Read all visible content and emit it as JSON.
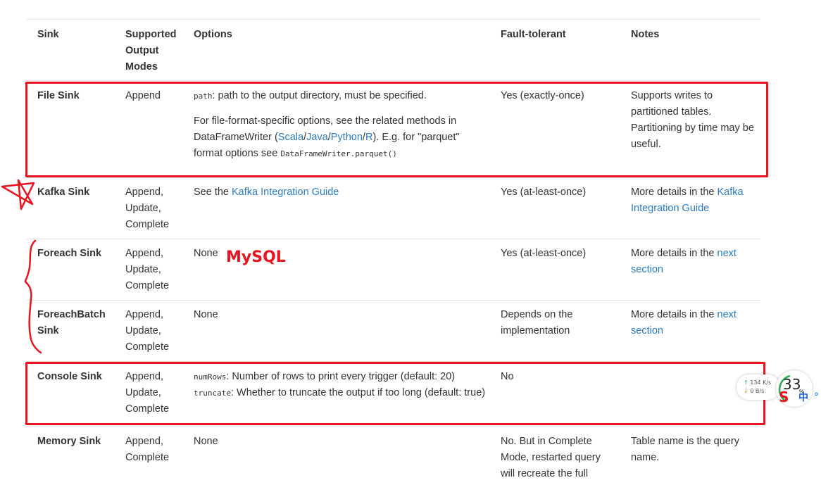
{
  "table": {
    "headers": {
      "sink": "Sink",
      "modes": "Supported Output Modes",
      "options": "Options",
      "fault": "Fault-tolerant",
      "notes": "Notes"
    },
    "rows": [
      {
        "sink": "File Sink",
        "modes": "Append",
        "options": {
          "code1": "path",
          "text1": ": path to the output directory, must be specified.",
          "p2_pre": "For file-format-specific options, see the related methods in DataFrameWriter (",
          "links": [
            "Scala",
            "Java",
            "Python",
            "R"
          ],
          "p2_mid": "). E.g. for \"parquet\" format options see ",
          "code2": "DataFrameWriter.parquet()"
        },
        "fault": "Yes (exactly-once)",
        "notes": "Supports writes to partitioned tables. Partitioning by time may be useful."
      },
      {
        "sink": "Kafka Sink",
        "modes": "Append, Update, Complete",
        "options": {
          "pre": "See the ",
          "link": "Kafka Integration Guide"
        },
        "fault": "Yes (at-least-once)",
        "notes": {
          "pre": "More details in the ",
          "link": "Kafka Integration Guide"
        }
      },
      {
        "sink": "Foreach Sink",
        "modes": "Append, Update, Complete",
        "options": "None",
        "fault": "Yes (at-least-once)",
        "notes": {
          "pre": "More details in the ",
          "link": "next section"
        }
      },
      {
        "sink": "ForeachBatch Sink",
        "modes": "Append, Update, Complete",
        "options": "None",
        "fault": "Depends on the implementation",
        "notes": {
          "pre": "More details in the ",
          "link": "next section"
        }
      },
      {
        "sink": "Console Sink",
        "modes": "Append, Update, Complete",
        "options": {
          "code1": "numRows",
          "text1": ": Number of rows to print every trigger (default: 20)",
          "code2": "truncate",
          "text2": ": Whether to truncate the output if too long (default: true)"
        },
        "fault": "No",
        "notes": ""
      },
      {
        "sink": "Memory Sink",
        "modes": "Append, Complete",
        "options": "None",
        "fault": "No. But in Complete Mode, restarted query will recreate the full",
        "notes": "Table name is the query name."
      }
    ]
  },
  "annotations": {
    "handwritten_label": "MySQL",
    "box_color": "#e8141f"
  },
  "overlay": {
    "upload_speed": "134 K/s",
    "download_speed": "0 B/s",
    "gauge_value": "33",
    "gauge_unit": "%",
    "ime_logo": "S",
    "ime_mode": "中",
    "ime_punct": "°"
  }
}
